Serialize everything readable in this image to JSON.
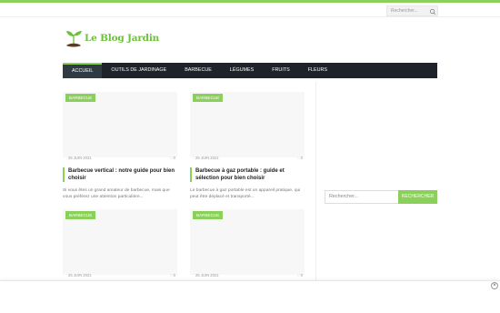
{
  "topbar": {
    "search_placeholder": "Rechercher...",
    "search_icon": "search-icon"
  },
  "logo": {
    "text": "Le Blog Jardin",
    "icon": "sprout-icon",
    "color": "#6dbf3f"
  },
  "nav": {
    "items": [
      "ACCUEIL",
      "OUTILS DE JARDINAGE",
      "BARBECUE",
      "LÉGUMES",
      "FRUITS",
      "FLEURS"
    ],
    "active": "ACCUEIL"
  },
  "cards": [
    {
      "tag": "Barbecue",
      "date": "25 JUIN 2021",
      "comments": "0",
      "title": "Barbecue vertical : notre guide pour bien choisir",
      "excerpt": "Si vous êtes un grand amateur de barbecue, mais que vous préférez une attention particulière..."
    },
    {
      "tag": "Barbecue",
      "date": "25 JUIN 2021",
      "comments": "0",
      "title": "Barbecue à gaz portable : guide et sélection pour bien choisir",
      "excerpt": "Le barbecue à gaz portable est un appareil pratique, qui peut être déplacé et transporté..."
    },
    {
      "tag": "Barbecue",
      "date": "25 JUIN 2021",
      "comments": "0"
    },
    {
      "tag": "Barbecue",
      "date": "25 JUIN 2021",
      "comments": "0"
    }
  ],
  "sidebar": {
    "search_placeholder": "Rechercher...",
    "search_button": "RECHERCHER"
  },
  "ad": {
    "close_label": "×"
  },
  "colors": {
    "accent": "#8bd05a",
    "nav_bg": "#1d2329"
  }
}
